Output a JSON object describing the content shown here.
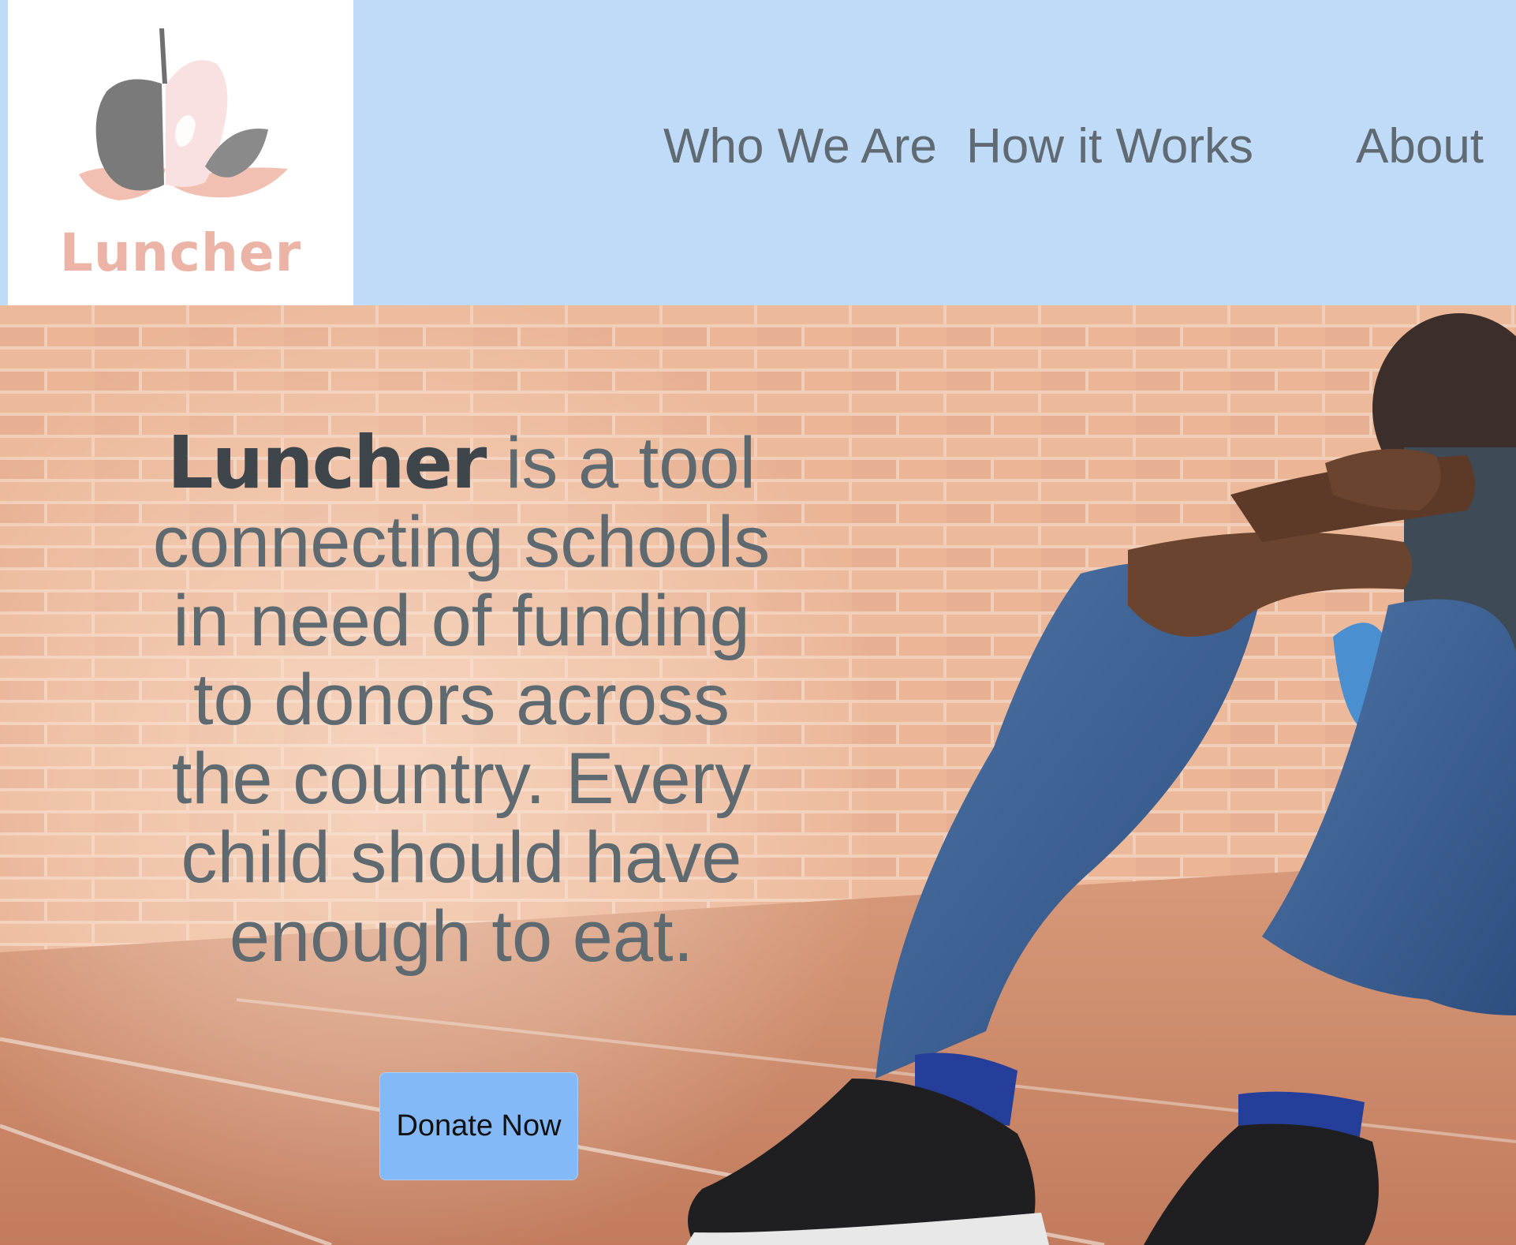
{
  "logo": {
    "text": "Luncher",
    "icon": "apple-logo-icon"
  },
  "nav": {
    "items": [
      {
        "label": "Who We Are"
      },
      {
        "label": "How it Works"
      },
      {
        "label": "About"
      }
    ]
  },
  "hero": {
    "brand": "Luncher",
    "tagline": " is a tool connecting schools in need of funding to donors across the country. Every child should have enough to eat.",
    "button_label": "Donate Now",
    "image": "child-sitting-by-brick-wall-photo"
  },
  "colors": {
    "header_bg": "#c0dbf8",
    "nav_text": "#5f6a72",
    "logo_accent": "#ecb4a6",
    "button_bg": "#84b9f7"
  }
}
